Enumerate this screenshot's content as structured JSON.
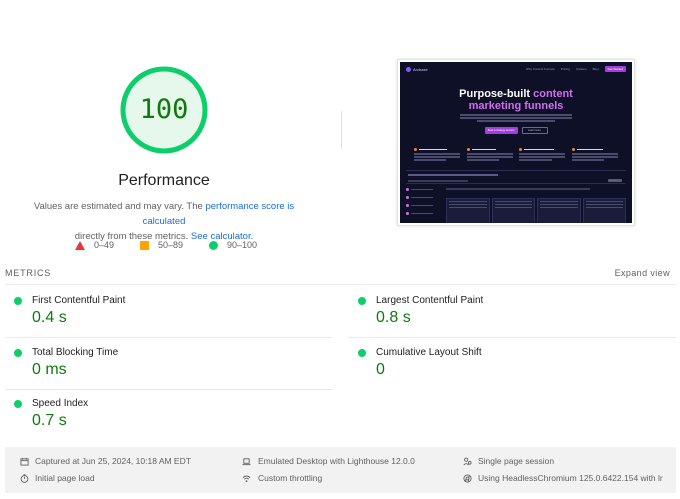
{
  "gauge": {
    "score": "100",
    "score_value": 100,
    "title": "Performance",
    "desc_prefix": "Values are estimated and may vary. The ",
    "desc_link1": "performance score is calculated",
    "desc_mid": "directly from these metrics. ",
    "desc_link2": "See calculator."
  },
  "legend": {
    "fail": "0–49",
    "average": "50–89",
    "pass": "90–100"
  },
  "thumbnail": {
    "brand": "Arcbase",
    "nav": [
      "Why Content Funnels",
      "Pricing",
      "Careers",
      "Blog"
    ],
    "nav_cta": "Get Started",
    "headline_1": "Purpose-built",
    "headline_accent": "content",
    "headline_2": "marketing funnels",
    "cta_primary": "Book a strategy session",
    "cta_secondary": "Learn more"
  },
  "metrics": {
    "section_label": "METRICS",
    "expand_label": "Expand view",
    "items": [
      {
        "name": "First Contentful Paint",
        "value": "0.4 s"
      },
      {
        "name": "Largest Contentful Paint",
        "value": "0.8 s"
      },
      {
        "name": "Total Blocking Time",
        "value": "0 ms"
      },
      {
        "name": "Cumulative Layout Shift",
        "value": "0"
      },
      {
        "name": "Speed Index",
        "value": "0.7 s"
      }
    ]
  },
  "footer": {
    "captured": "Captured at Jun 25, 2024, 10:18 AM EDT",
    "emulated": "Emulated Desktop with Lighthouse 12.0.0",
    "session": "Single page session",
    "load": "Initial page load",
    "throttling": "Custom throttling",
    "browser": "Using HeadlessChromium 125.0.6422.154 with lr"
  },
  "colors": {
    "pass": "#0cce6b",
    "pass_text": "#0c7a0c",
    "average": "#ffa400",
    "fail": "#e53935",
    "link": "#1a6cd8"
  },
  "icons": {
    "captured": "calendar-icon",
    "emulated": "laptop-icon",
    "session": "user-session-icon",
    "load": "timer-icon",
    "throttling": "wifi-icon",
    "browser": "chromium-icon"
  }
}
